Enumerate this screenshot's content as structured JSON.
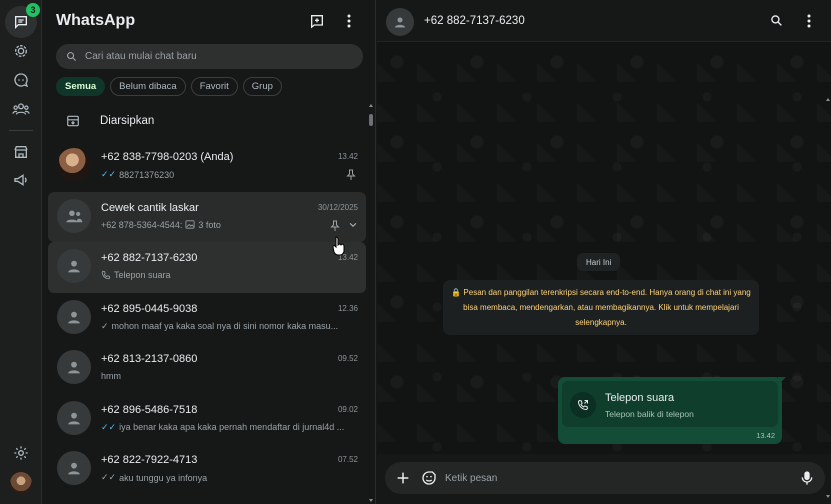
{
  "rail": {
    "chats_badge": "3"
  },
  "header": {
    "title": "WhatsApp"
  },
  "search": {
    "placeholder": "Cari atau mulai chat baru"
  },
  "filters": [
    "Semua",
    "Belum dibaca",
    "Favorit",
    "Grup"
  ],
  "archived_label": "Diarsipkan",
  "chats": [
    {
      "name": "+62 838-7798-0203 (Anda)",
      "time": "13.42",
      "preview": "88271376230",
      "ticks": "✓✓"
    },
    {
      "name": "Cewek cantik laskar",
      "time": "30/12/2025",
      "preview": "+62 878-5364-4544:",
      "media": "3 foto"
    },
    {
      "name": "+62 882-7137-6230",
      "time": "13.42",
      "preview": "Telepon suara"
    },
    {
      "name": "+62 895-0445-9038",
      "time": "12.36",
      "preview": "mohon maaf ya kaka soal nya di sini nomor kaka masu...",
      "ticks": "✓"
    },
    {
      "name": "+62 813-2137-0860",
      "time": "09.52",
      "preview": "hmm"
    },
    {
      "name": "+62 896-5486-7518",
      "time": "09.02",
      "preview": "iya benar kaka apa kaka pernah mendaftar di jurnal4d ...",
      "ticks": "✓✓"
    },
    {
      "name": "+62 822-7922-4713",
      "time": "07.52",
      "preview": "aku tunggu ya infonya",
      "ticks": "✓✓"
    }
  ],
  "conversation": {
    "title": "+62 882-7137-6230",
    "date_label": "Hari Ini",
    "encryption_notice": "🔒 Pesan dan panggilan terenkripsi secara end-to-end. Hanya orang di chat ini yang bisa membaca, mendengarkan, atau membagikannya. Klik untuk mempelajari selengkapnya.",
    "call": {
      "title": "Telepon suara",
      "subtitle": "Telepon balik di telepon",
      "time": "13.42"
    },
    "composer_placeholder": "Ketik pesan"
  },
  "colors": {
    "accent": "#21c063",
    "bubble_out": "#144d37",
    "notice_text": "#ffd279",
    "read_ticks": "#53bdeb"
  }
}
